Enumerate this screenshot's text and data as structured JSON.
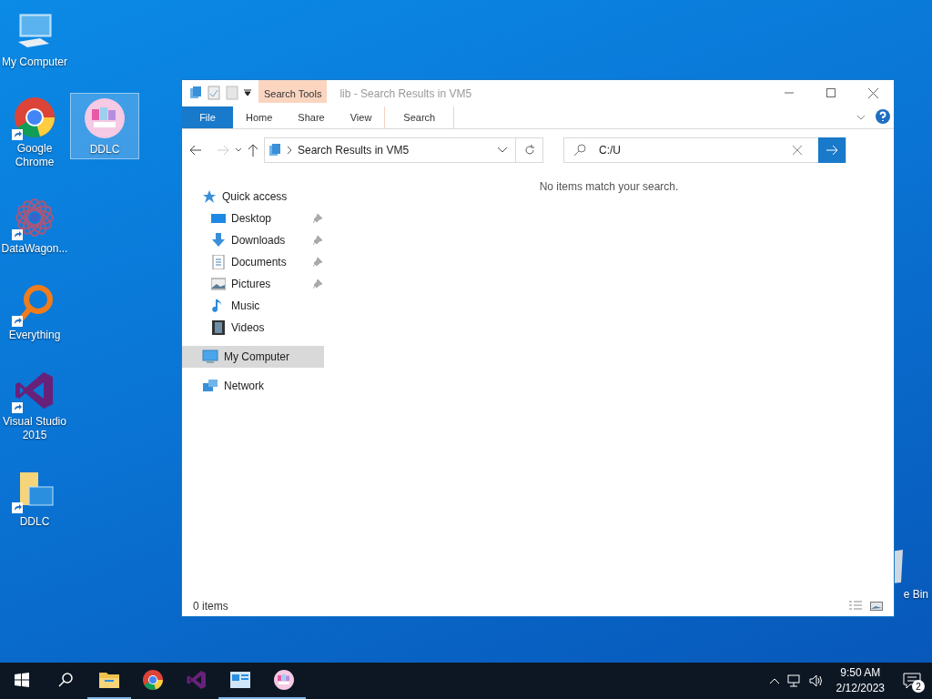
{
  "desktop": {
    "columns": [
      {
        "icons": [
          {
            "kind": "computer",
            "label": "My Computer",
            "shortcut": false,
            "selected": false
          },
          {
            "kind": "chrome",
            "label": "Google Chrome",
            "shortcut": true,
            "selected": false
          },
          {
            "kind": "datawagon",
            "label": "DataWagon...",
            "shortcut": true,
            "selected": false
          },
          {
            "kind": "everything",
            "label": "Everything",
            "shortcut": true,
            "selected": false
          },
          {
            "kind": "vs",
            "label": "Visual Studio 2015",
            "shortcut": true,
            "selected": false
          },
          {
            "kind": "folder",
            "label": "DDLC",
            "shortcut": true,
            "selected": false
          }
        ]
      },
      {
        "icons": [
          {
            "kind": "ddlc",
            "label": "DDLC",
            "shortcut": false,
            "selected": true
          }
        ]
      }
    ],
    "recycle_bin": {
      "label": "e Bin"
    }
  },
  "window": {
    "title": "lib - Search Results in VM5",
    "context_group": "Search Tools",
    "ribbon_tabs": [
      {
        "kind": "file",
        "label": "File",
        "contextual": false
      },
      {
        "kind": "tab",
        "label": "Home",
        "contextual": false
      },
      {
        "kind": "tab",
        "label": "Share",
        "contextual": false
      },
      {
        "kind": "tab",
        "label": "View",
        "contextual": false
      },
      {
        "kind": "tab",
        "label": "Search",
        "contextual": true
      }
    ],
    "address": {
      "path": "Search Results in VM5"
    },
    "search": {
      "value": "C:/U"
    },
    "nav": [
      {
        "kind": "star",
        "label": "Quick access",
        "selected": false,
        "children": [
          {
            "kind": "desktop",
            "label": "Desktop",
            "pinned": true,
            "selected": false
          },
          {
            "kind": "downloads",
            "label": "Downloads",
            "pinned": true,
            "selected": false
          },
          {
            "kind": "documents",
            "label": "Documents",
            "pinned": true,
            "selected": false
          },
          {
            "kind": "pictures",
            "label": "Pictures",
            "pinned": true,
            "selected": false
          },
          {
            "kind": "music",
            "label": "Music",
            "pinned": false,
            "selected": false
          },
          {
            "kind": "videos",
            "label": "Videos",
            "pinned": false,
            "selected": false
          }
        ]
      },
      {
        "kind": "computer",
        "label": "My Computer",
        "selected": true
      },
      {
        "kind": "network",
        "label": "Network",
        "selected": false
      }
    ],
    "empty_message": "No items match your search.",
    "status": {
      "count": "0 items"
    }
  },
  "taskbar": {
    "items": [
      {
        "kind": "start",
        "running": false
      },
      {
        "kind": "search",
        "running": false
      },
      {
        "kind": "explorer",
        "running": true
      },
      {
        "kind": "chrome",
        "running": false
      },
      {
        "kind": "vs",
        "running": false
      },
      {
        "kind": "app",
        "running": true
      },
      {
        "kind": "ddlc",
        "running": true
      }
    ],
    "time": "9:50 AM",
    "date": "2/12/2023",
    "notifications": "2"
  }
}
